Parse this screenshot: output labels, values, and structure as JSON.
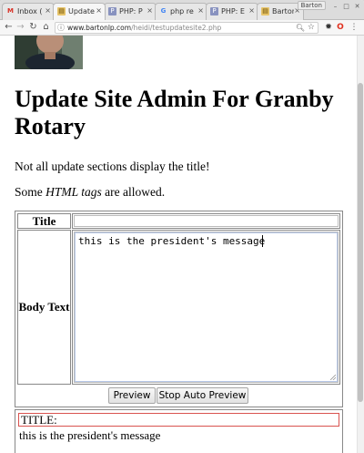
{
  "browser": {
    "tabs": [
      {
        "label": "Inbox (",
        "icon": "gmail-icon",
        "close": "×"
      },
      {
        "label": "Update",
        "icon": "page-icon",
        "close": "×"
      },
      {
        "label": "PHP: P",
        "icon": "php-icon",
        "close": "×"
      },
      {
        "label": "php re",
        "icon": "google-icon",
        "close": "×"
      },
      {
        "label": "PHP: E",
        "icon": "php-icon",
        "close": "×"
      },
      {
        "label": "Barton",
        "icon": "page-icon",
        "close": "×"
      }
    ],
    "profile_name": "Barton",
    "url_domain": "www.bartonlp.com",
    "url_path": "/heidi/testupdatesite2.php"
  },
  "page": {
    "title": "Update Site Admin For Granby Rotary",
    "note_title": "Not all update sections display the title!",
    "note_html_before": "Some ",
    "note_html_em": "HTML tags",
    "note_html_after": " are allowed.",
    "form": {
      "title_label": "Title",
      "title_value": "",
      "body_label": "Body Text",
      "body_value": "this is the president's message",
      "preview_button": "Preview",
      "stop_button": "Stop Auto Preview"
    },
    "preview": {
      "title_text": "TITLE:",
      "body_text": "this is the president's message"
    }
  },
  "colors": {
    "preview_title_border": "#d9534f",
    "textarea_focus": "#b8c9e8"
  }
}
